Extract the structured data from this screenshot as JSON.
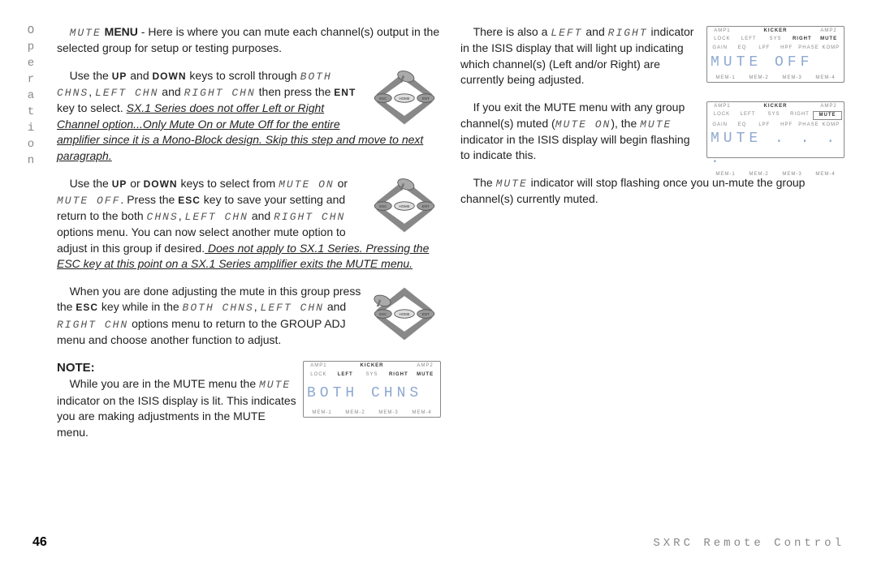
{
  "tab": "Operation",
  "footer": {
    "page": "46",
    "title": "SXRC Remote Control"
  },
  "col1": {
    "p1a": " - Here is where you can mute each channel(s) output in the selected group for setup or testing purposes.",
    "mute_menu_label": "MUTE",
    "menu_label": "MENU",
    "p2a": "Use the ",
    "up": "UP",
    "p2b": " and ",
    "down": "DOWN",
    "p2c": " keys to scroll through ",
    "both_chns": "BOTH CHNS",
    "comma": ", ",
    "left_chn": "LEFT CHN",
    "p2d": " and ",
    "right_chn": "RIGHT CHN",
    "p2e": " then press the ",
    "ent": "ENT",
    "p2f": " key to select. ",
    "p2g": "SX.1 Series does not offer Left or Right Channel option...Only Mute On or Mute Off for the entire amplifier since it is a Mono-Block design. Skip this step and move to next paragraph.",
    "p3a": "Use the ",
    "p3b": " or ",
    "p3c": " keys to select from ",
    "mute_on": "MUTE ON",
    "p3d": " or ",
    "mute_off": "MUTE OFF",
    "p3e": ". Press the ",
    "esc": "ESC",
    "p3f": " key to save your setting and return to the both ",
    "chns": "CHNS",
    "p3g": " and ",
    "p3h": " options menu. You can now select another mute option to adjust in this group if desired.",
    "p3i": " Does not apply to SX.1 Series. Pressing the ESC key at this point on a SX.1 Series amplifier exits the MUTE menu.",
    "p4a": "When you are done adjusting the mute in this group press the ",
    "p4b": " key while in the ",
    "p4c": " and ",
    "p4d": " options menu to return to the GROUP ADJ menu and choose another function to adjust.",
    "note": "NOTE:",
    "p5a": "While you are in the MUTE menu the ",
    "p5b": " indicator on the ISIS display is lit. This indicates you are making adjustments in the MUTE menu.",
    "isis1_main": "BOTH CHNS"
  },
  "col2": {
    "p1a": "There is also a ",
    "left": "LEFT",
    "p1b": " and ",
    "right": "RIGHT",
    "p1c": " indicator in the ISIS display that will light up indicating which channel(s) (Left and/or Right) are currently being adjusted.",
    "isis2_main": "MUTE OFF",
    "p2a": "If you exit the MUTE menu with any group channel(s) muted (",
    "mute_on": "MUTE ON",
    "p2b": "), the ",
    "mute": "MUTE",
    "p2c": " indicator in the ISIS display will begin flashing to indicate this.",
    "isis3_main": "MUTE . . . .",
    "p3a": "The ",
    "p3b": " indicator will stop flashing once you un-mute the group channel(s) currently muted."
  },
  "isis_labels": {
    "r1": [
      "AMP1",
      "",
      "KICKER",
      "",
      "AMP2"
    ],
    "r2": [
      "LOCK",
      "LEFT",
      "SYS",
      "RIGHT",
      "MUTE"
    ],
    "r3": [
      "GAIN",
      "EQ",
      "LPF",
      "HPF",
      "PHASE",
      "KOMP"
    ],
    "r4": [
      "MEM-1",
      "MEM-2",
      "MEM-3",
      "MEM-4"
    ]
  },
  "remote_labels": {
    "esc": "ESC",
    "home": "HOME",
    "ent": "ENT"
  }
}
